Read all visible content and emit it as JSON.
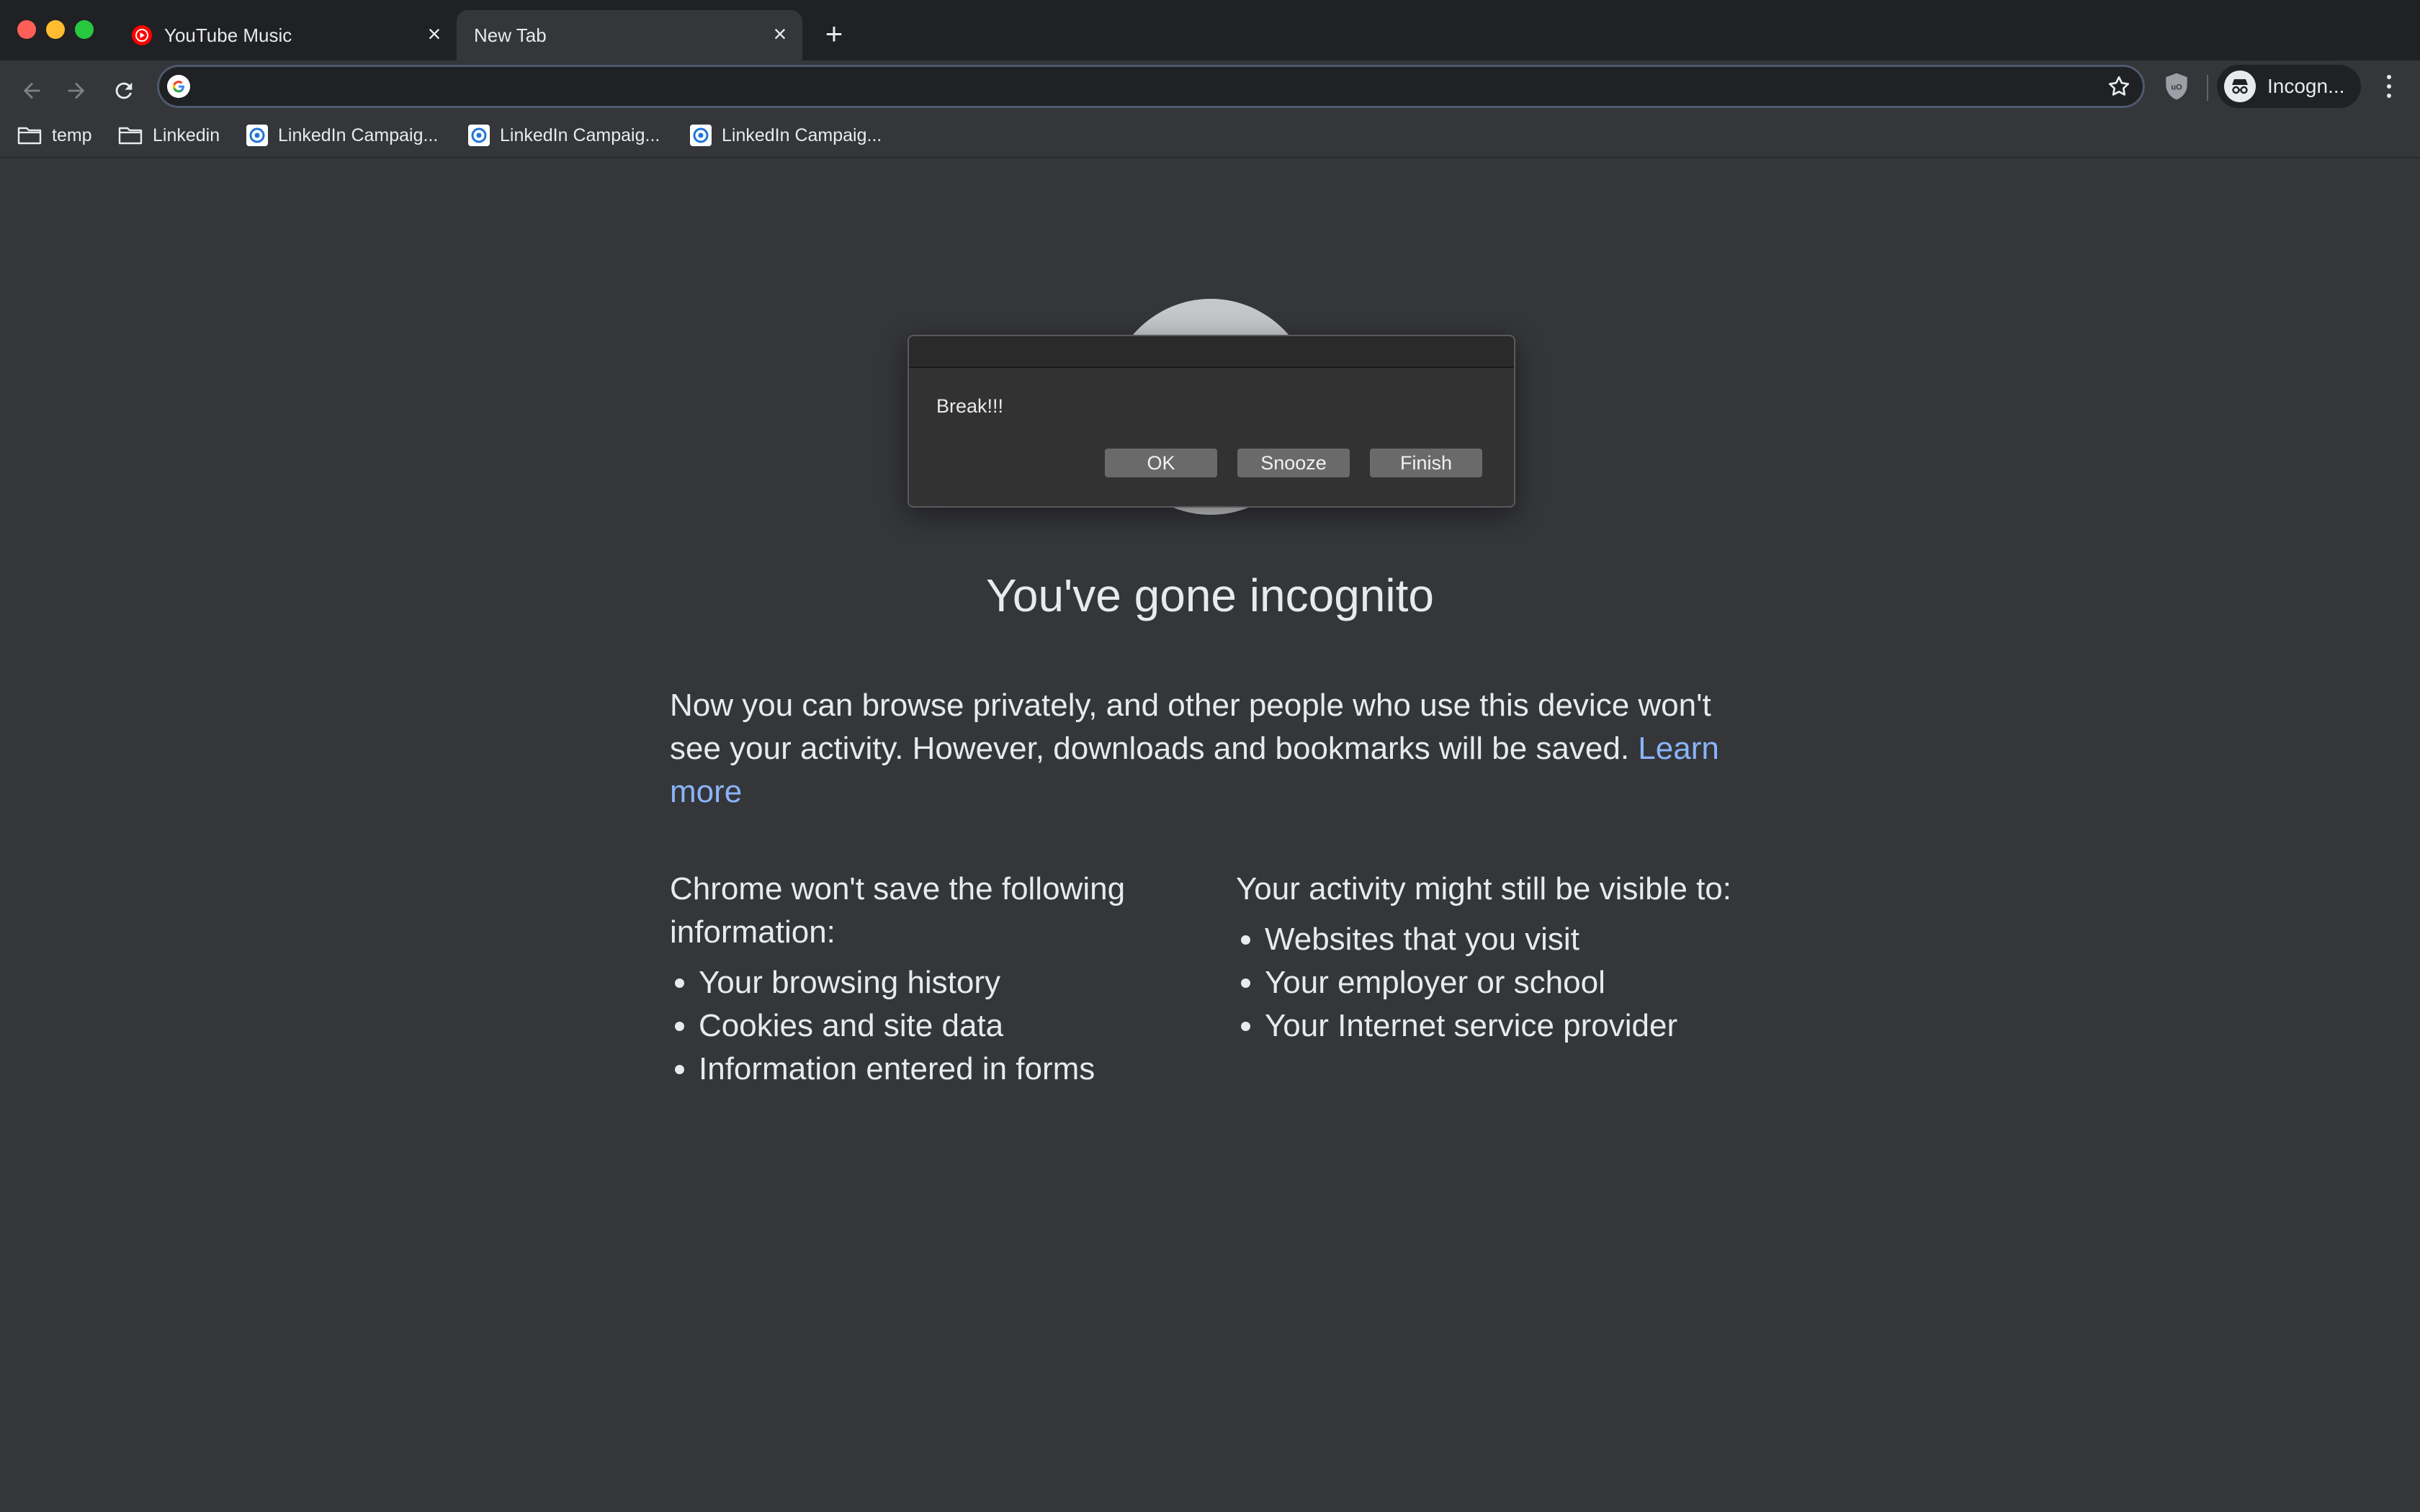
{
  "window": {
    "tabs": [
      {
        "title": "YouTube Music",
        "favicon": "youtube-music-icon"
      },
      {
        "title": "New Tab",
        "active": true
      }
    ]
  },
  "toolbar": {
    "address_value": "",
    "profile_label": "Incogn..."
  },
  "bookmarks": [
    {
      "label": "temp",
      "icon": "folder-icon"
    },
    {
      "label": "Linkedin",
      "icon": "folder-icon"
    },
    {
      "label": "LinkedIn Campaig...",
      "icon": "linkedin-campaign-icon"
    },
    {
      "label": "LinkedIn Campaig...",
      "icon": "linkedin-campaign-icon"
    },
    {
      "label": "LinkedIn Campaig...",
      "icon": "linkedin-campaign-icon"
    }
  ],
  "page": {
    "headline": "You've gone incognito",
    "intro": "Now you can browse privately, and other people who use this device won't see your activity. However, downloads and bookmarks will be saved.",
    "learn_more": "Learn more",
    "left_heading": "Chrome won't save the following information:",
    "left_items": [
      "Your browsing history",
      "Cookies and site data",
      "Information entered in forms"
    ],
    "right_heading": "Your activity might still be visible to:",
    "right_items": [
      "Websites that you visit",
      "Your employer or school",
      "Your Internet service provider"
    ]
  },
  "dialog": {
    "message": "Break!!!",
    "buttons": {
      "ok": "OK",
      "snooze": "Snooze",
      "finish": "Finish"
    }
  },
  "colors": {
    "background": "#35363a",
    "tabstrip": "#202124",
    "link": "#8ab4f8",
    "dialog_button": "#6a6a6a"
  }
}
